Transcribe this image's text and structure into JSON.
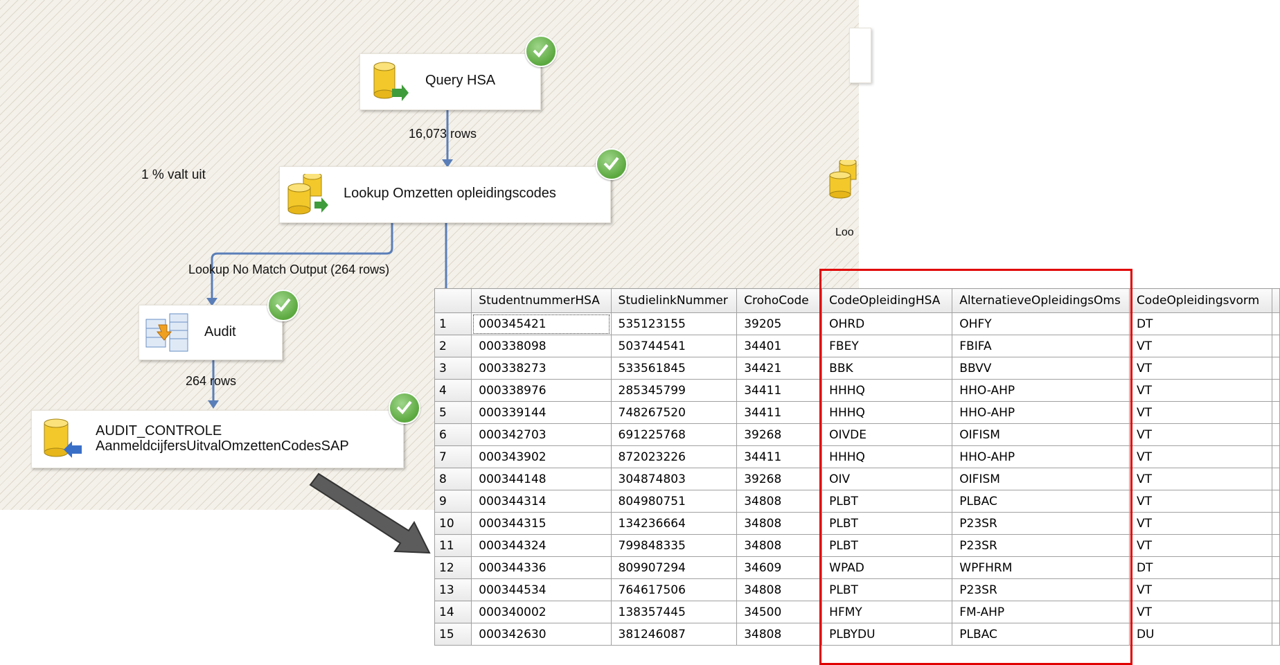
{
  "flow": {
    "query_hsa": "Query HSA",
    "rows_query": "16,073 rows",
    "lookup": "Lookup Omzetten opleidingscodes",
    "annotation": "1 % valt uit",
    "no_match": "Lookup No Match Output (264 rows)",
    "audit": "Audit",
    "rows_audit": "264 rows",
    "dest_line1": "AUDIT_CONTROLE",
    "dest_line2": "AanmeldcijfersUitvalOmzettenCodesSAP",
    "partial_lookup": "Loo"
  },
  "icons": [
    "database-icon",
    "lookup-icon",
    "audit-icon",
    "destination-icon",
    "check-icon",
    "arrow-icon"
  ],
  "colors": {
    "connector": "#5a7eb8",
    "check": "#5ba83f",
    "highlight": "#e00000"
  },
  "grid": {
    "columns": [
      "StudentnummerHSA",
      "StudielinkNummer",
      "CrohoCode",
      "CodeOpleidingHSA",
      "AlternatieveOpleidingsOms",
      "CodeOpleidingsvorm"
    ],
    "rows": [
      {
        "n": "1",
        "c": [
          "000345421",
          "535123155",
          "39205",
          "OHRD",
          "OHFY",
          "DT"
        ]
      },
      {
        "n": "2",
        "c": [
          "000338098",
          "503744541",
          "34401",
          "FBEY",
          "FBIFA",
          "VT"
        ]
      },
      {
        "n": "3",
        "c": [
          "000338273",
          "533561845",
          "34421",
          "BBK",
          "BBVV",
          "VT"
        ]
      },
      {
        "n": "4",
        "c": [
          "000338976",
          "285345799",
          "34411",
          "HHHQ",
          "HHO-AHP",
          "VT"
        ]
      },
      {
        "n": "5",
        "c": [
          "000339144",
          "748267520",
          "34411",
          "HHHQ",
          "HHO-AHP",
          "VT"
        ]
      },
      {
        "n": "6",
        "c": [
          "000342703",
          "691225768",
          "39268",
          "OIVDE",
          "OIFISM",
          "VT"
        ]
      },
      {
        "n": "7",
        "c": [
          "000343902",
          "872023226",
          "34411",
          "HHHQ",
          "HHO-AHP",
          "VT"
        ]
      },
      {
        "n": "8",
        "c": [
          "000344148",
          "304874803",
          "39268",
          "OIV",
          "OIFISM",
          "VT"
        ]
      },
      {
        "n": "9",
        "c": [
          "000344314",
          "804980751",
          "34808",
          "PLBT",
          "PLBAC",
          "VT"
        ]
      },
      {
        "n": "10",
        "c": [
          "000344315",
          "134236664",
          "34808",
          "PLBT",
          "P23SR",
          "VT"
        ]
      },
      {
        "n": "11",
        "c": [
          "000344324",
          "799848335",
          "34808",
          "PLBT",
          "P23SR",
          "VT"
        ]
      },
      {
        "n": "12",
        "c": [
          "000344336",
          "809907294",
          "34609",
          "WPAD",
          "WPFHRM",
          "DT"
        ]
      },
      {
        "n": "13",
        "c": [
          "000344534",
          "764617506",
          "34808",
          "PLBT",
          "P23SR",
          "VT"
        ]
      },
      {
        "n": "14",
        "c": [
          "000340002",
          "138357445",
          "34500",
          "HFMY",
          "FM-AHP",
          "VT"
        ]
      },
      {
        "n": "15",
        "c": [
          "000342630",
          "381246087",
          "34808",
          "PLBYDU",
          "PLBAC",
          "DU"
        ]
      }
    ]
  }
}
